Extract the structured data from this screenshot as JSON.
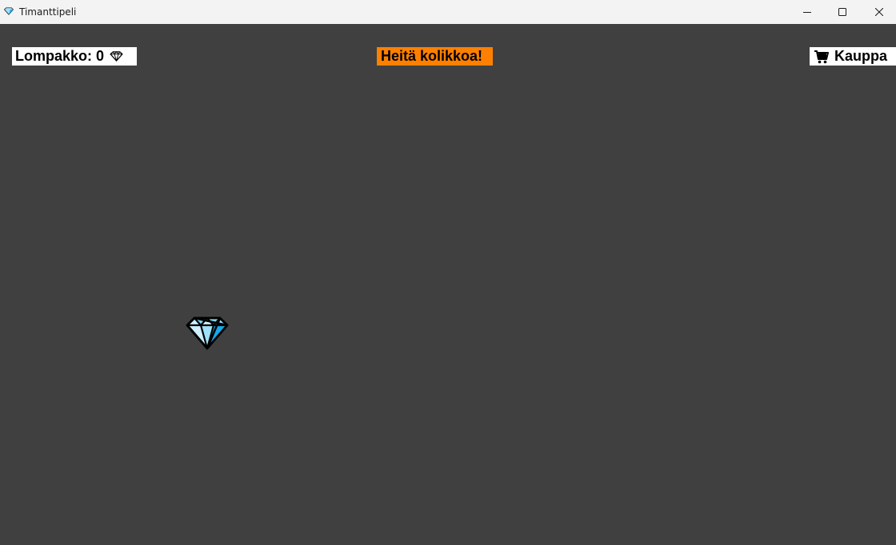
{
  "window": {
    "title": "Timanttipeli",
    "app_icon": "diamond-icon",
    "controls": [
      "minimize-icon",
      "maximize-icon",
      "close-icon"
    ]
  },
  "hud": {
    "wallet_label": "Lompakko: 0",
    "wallet_icon": "diamond-icon",
    "flip_label": "Heitä kolikkoa!",
    "shop_label": "Kauppa",
    "shop_icon": "cart-icon"
  },
  "game": {
    "collectible": "diamond-icon"
  },
  "colors": {
    "background": "#404040",
    "flip_button": "#ff8000",
    "label_bg": "#ffffff",
    "diamond_light": "#cdefff",
    "diamond_mid": "#7fd4f7",
    "diamond_dark": "#18a7e8"
  }
}
